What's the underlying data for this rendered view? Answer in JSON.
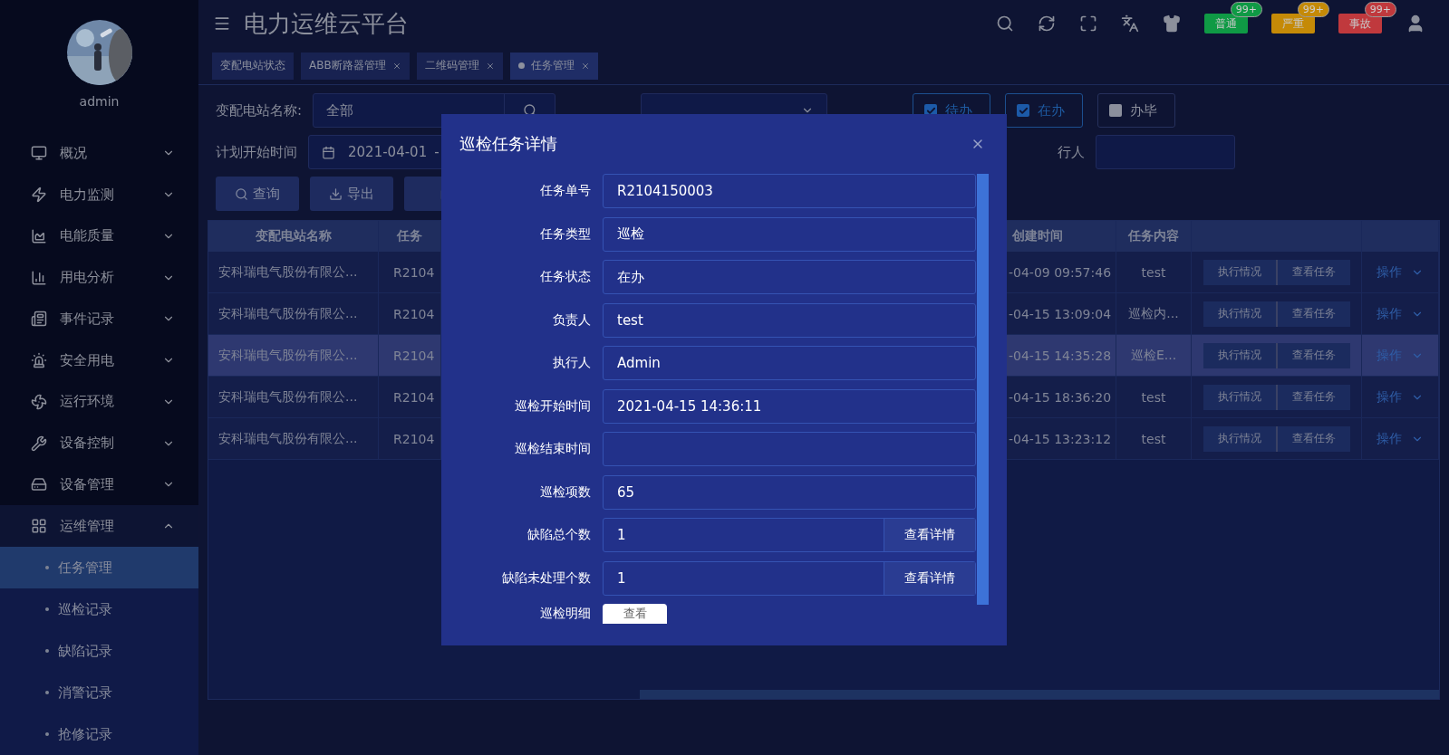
{
  "sidebar": {
    "user": "admin",
    "menu": [
      {
        "label": "概况",
        "expanded": false
      },
      {
        "label": "电力监测",
        "expanded": false
      },
      {
        "label": "电能质量",
        "expanded": false
      },
      {
        "label": "用电分析",
        "expanded": false
      },
      {
        "label": "事件记录",
        "expanded": false
      },
      {
        "label": "安全用电",
        "expanded": false
      },
      {
        "label": "运行环境",
        "expanded": false
      },
      {
        "label": "设备控制",
        "expanded": false
      },
      {
        "label": "设备管理",
        "expanded": false
      },
      {
        "label": "运维管理",
        "expanded": true,
        "children": [
          {
            "label": "任务管理",
            "selected": true
          },
          {
            "label": "巡检记录",
            "selected": false
          },
          {
            "label": "缺陷记录",
            "selected": false
          },
          {
            "label": "消警记录",
            "selected": false
          },
          {
            "label": "抢修记录",
            "selected": false
          }
        ]
      }
    ]
  },
  "header": {
    "title": "电力运维云平台",
    "alerts": [
      {
        "label": "普通",
        "count": "99+",
        "color": "#0f9a45"
      },
      {
        "label": "严重",
        "count": "99+",
        "color": "#c58a07"
      },
      {
        "label": "事故",
        "count": "99+",
        "color": "#c0393d"
      }
    ]
  },
  "tabs": [
    {
      "label": "变配电站状态",
      "selected": false,
      "closable": false
    },
    {
      "label": "ABB断路器管理",
      "selected": false,
      "closable": true
    },
    {
      "label": "二维码管理",
      "selected": false,
      "closable": true
    },
    {
      "label": "任务管理",
      "selected": true,
      "closable": true
    }
  ],
  "filters": {
    "station_label": "变配电站名称:",
    "station_value": "全部",
    "statuses": [
      {
        "label": "待办",
        "checked": true
      },
      {
        "label": "在办",
        "checked": true
      },
      {
        "label": "办毕",
        "checked": false
      }
    ],
    "date_label": "计划开始时间",
    "date_start": "2021-04-01",
    "date_sep": "-",
    "executor_label": "行人",
    "buttons": [
      {
        "label": "查询",
        "kind": "search"
      },
      {
        "label": "导出",
        "kind": "export"
      },
      {
        "kind": "clipboard"
      }
    ]
  },
  "table": {
    "columns": [
      "变配电站名称",
      "任务",
      "创建时间",
      "任务内容"
    ],
    "rows": [
      {
        "station": "安科瑞电气股份有限公...",
        "task_no": "R2104",
        "created": "-04-09 09:57:46",
        "content": "test",
        "actions": [
          "执行情况",
          "查看任务"
        ],
        "menu": "操作",
        "highlighted": false
      },
      {
        "station": "安科瑞电气股份有限公...",
        "task_no": "R2104",
        "created": "-04-15 13:09:04",
        "content": "巡检内...",
        "actions": [
          "执行情况",
          "查看任务"
        ],
        "menu": "操作",
        "highlighted": false
      },
      {
        "station": "安科瑞电气股份有限公...",
        "task_no": "R2104",
        "created": "-04-15 14:35:28",
        "content": "巡检E...",
        "actions": [
          "执行情况",
          "查看任务"
        ],
        "menu": "操作",
        "highlighted": true
      },
      {
        "station": "安科瑞电气股份有限公...",
        "task_no": "R2104",
        "created": "-04-15 18:36:20",
        "content": "test",
        "actions": [
          "执行情况",
          "查看任务"
        ],
        "menu": "操作",
        "highlighted": false
      },
      {
        "station": "安科瑞电气股份有限公...",
        "task_no": "R2104",
        "created": "-04-15 13:23:12",
        "content": "test",
        "actions": [
          "执行情况",
          "查看任务"
        ],
        "menu": "操作",
        "highlighted": false
      }
    ]
  },
  "dialog": {
    "title": "巡检任务详情",
    "fields": [
      {
        "label": "任务单号",
        "value": "R2104150003",
        "kind": "text"
      },
      {
        "label": "任务类型",
        "value": "巡检",
        "kind": "text"
      },
      {
        "label": "任务状态",
        "value": "在办",
        "kind": "text"
      },
      {
        "label": "负责人",
        "value": "test",
        "kind": "text"
      },
      {
        "label": "执行人",
        "value": "Admin",
        "kind": "text"
      },
      {
        "label": "巡检开始时间",
        "value": "2021-04-15 14:36:11",
        "kind": "text"
      },
      {
        "label": "巡检结束时间",
        "kind": "text"
      },
      {
        "label": "巡检项数",
        "value": "65",
        "kind": "text"
      },
      {
        "label": "缺陷总个数",
        "value": "1",
        "kind": "action",
        "action": "查看详情"
      },
      {
        "label": "缺陷未处理个数",
        "value": "1",
        "kind": "action",
        "action": "查看详情"
      },
      {
        "label": "巡检明细",
        "kind": "button",
        "action": "查看"
      }
    ]
  }
}
